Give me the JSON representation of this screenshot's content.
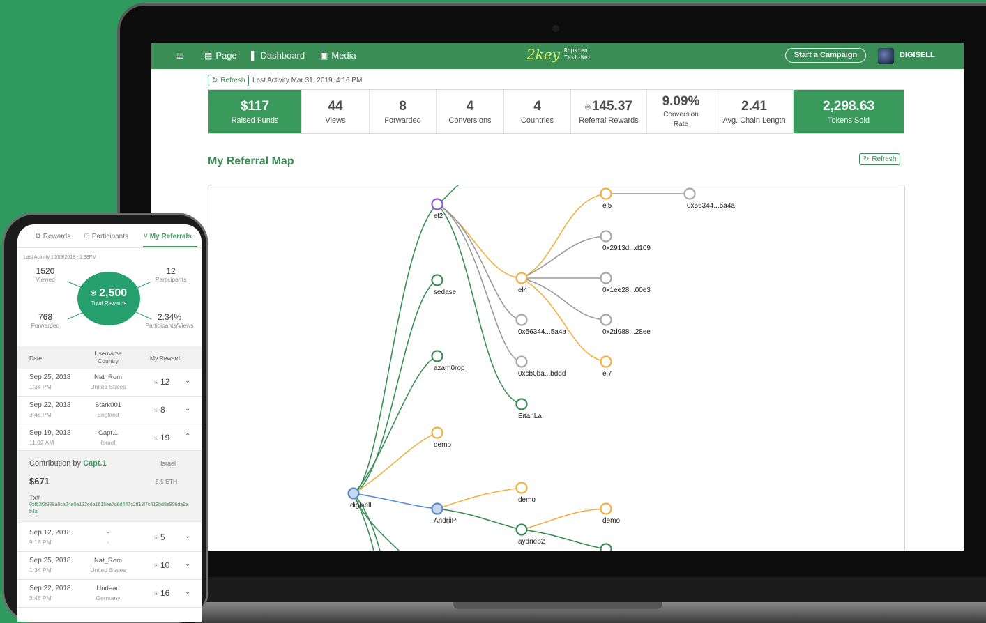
{
  "topbar": {
    "nav": [
      {
        "icon": "page-icon",
        "label": "Page"
      },
      {
        "icon": "dashboard-icon",
        "label": "Dashboard"
      },
      {
        "icon": "media-icon",
        "label": "Media"
      }
    ],
    "logo_text": "2key",
    "network_line1": "Ropsten",
    "network_line2": "Test-Net",
    "campaign_button": "Start a Campaign",
    "user_name": "DIGISELL"
  },
  "summary": {
    "refresh_label": "Refresh",
    "last_activity": "Last Activity Mar 31, 2019, 4:16 PM",
    "stats": [
      {
        "value": "$117",
        "label": "Raised Funds"
      },
      {
        "value": "44",
        "label": "Views"
      },
      {
        "value": "8",
        "label": "Forwarded"
      },
      {
        "value": "4",
        "label": "Conversions"
      },
      {
        "value": "4",
        "label": "Countries"
      },
      {
        "value": "145.37",
        "label": "Referral Rewards"
      },
      {
        "value": "9.09%",
        "label": "Conversion",
        "label2": "Rate"
      },
      {
        "value": "2.41",
        "label": "Avg. Chain Length"
      },
      {
        "value": "2,298.63",
        "label": "Tokens Sold"
      }
    ]
  },
  "referral_map": {
    "title": "My Referral Map",
    "refresh_label": "Refresh",
    "nodes": {
      "el2": "el2",
      "sedase": "sedase",
      "azam0rop": "azam0rop",
      "demo1": "demo",
      "digisell": "digisell",
      "andriipi": "AndriiPi",
      "el4": "el4",
      "n0x56344_a": "0x56344...5a4a",
      "n0xcb0ba": "0xcb0ba...bddd",
      "eitanla": "EitanLa",
      "demo2": "demo",
      "aydnep2": "aydnep2",
      "el5": "el5",
      "n0x2913d": "0x2913d...d109",
      "n0x1ee28": "0x1ee28...00e3",
      "n0x2d988": "0x2d988...28ee",
      "el7": "el7",
      "demo3": "demo",
      "n0x56344_b": "0x56344...5a4a"
    }
  },
  "phone": {
    "tabs": [
      "Rewards",
      "Participants",
      "My Referrals"
    ],
    "last_activity": "Last Activity 10/09/2018 - 1:38PM",
    "viewed": {
      "value": "1520",
      "label": "Viewed"
    },
    "participants": {
      "value": "12",
      "label": "Participants"
    },
    "forwarded": {
      "value": "768",
      "label": "Forwarded"
    },
    "ratio": {
      "value": "2.34%",
      "label": "Participants/Views"
    },
    "total_rewards": {
      "value": "2,500",
      "label": "Total Rewards"
    },
    "table_headers": {
      "date": "Date",
      "username": "Username",
      "country": "Country",
      "reward": "My Reward"
    },
    "rows": [
      {
        "date": "Sep 25, 2018",
        "time": "1:34 PM",
        "user": "Nat_Rom",
        "country": "United States",
        "reward": "12",
        "chevron": "⌄"
      },
      {
        "date": "Sep 22, 2018",
        "time": "3:48 PM",
        "user": "Stark001",
        "country": "England",
        "reward": "8",
        "chevron": "⌄"
      },
      {
        "date": "Sep 19, 2018",
        "time": "11:02 AM",
        "user": "Capt.1",
        "country": "Israel",
        "reward": "19",
        "chevron": "⌃"
      },
      {
        "date": "Sep 12, 2018",
        "time": "9:16 PM",
        "user": "-",
        "country": "-",
        "reward": "5",
        "chevron": "⌄"
      },
      {
        "date": "Sep 25, 2018",
        "time": "1:34 PM",
        "user": "Nat_Rom",
        "country": "United States",
        "reward": "10",
        "chevron": "⌄"
      },
      {
        "date": "Sep 22, 2018",
        "time": "3:48 PM",
        "user": "Undead",
        "country": "Germany",
        "reward": "16",
        "chevron": "⌄"
      }
    ],
    "contribution": {
      "prefix": "Contribution by",
      "user": "Capt.1",
      "country": "Israel",
      "amount": "$671",
      "eth": "5.5 ETH",
      "tx_label": "Tx#",
      "tx_value": "0xf63f2f988a0ca24e0e132eda1615ea7d6d447c2ff12f7c413bd8a806da9ab4a"
    }
  },
  "colors": {
    "brand_green": "#3a8e55",
    "accent_green": "#3a9a5c",
    "node_orange": "#f0b040",
    "node_purple": "#8e5ad8",
    "node_gray": "#a8a8a8",
    "node_blue": "#5b8bd0"
  }
}
